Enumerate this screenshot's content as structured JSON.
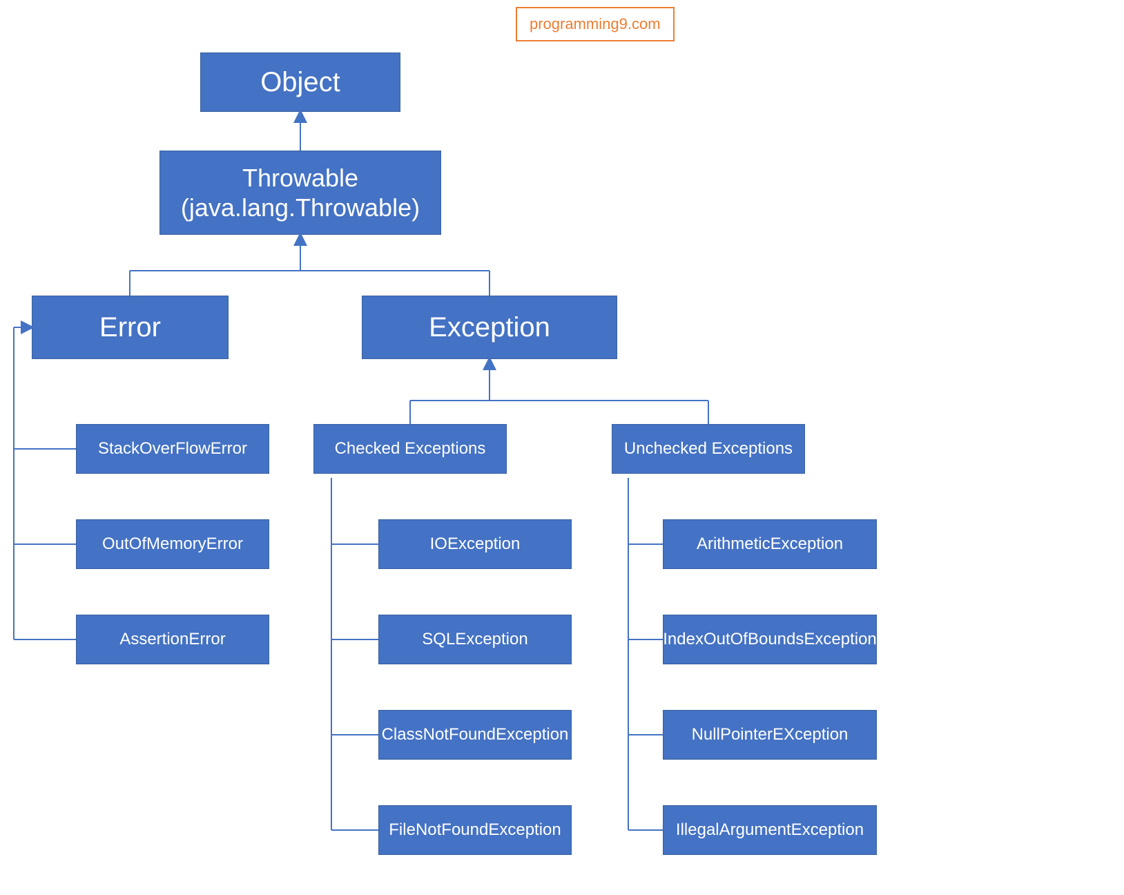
{
  "watermark": "programming9.com",
  "nodes": {
    "object": "Object",
    "throwable_line1": "Throwable",
    "throwable_line2": "(java.lang.Throwable)",
    "error": "Error",
    "exception": "Exception",
    "checked": "Checked Exceptions",
    "unchecked": "Unchecked Exceptions",
    "error_children": {
      "stackoverflow": "StackOverFlowError",
      "outofmemory": "OutOfMemoryError",
      "assertion": "AssertionError"
    },
    "checked_children": {
      "io": "IOException",
      "sql": "SQLException",
      "cnf": "ClassNotFoundException",
      "fnf": "FileNotFoundException"
    },
    "unchecked_children": {
      "arith": "ArithmeticException",
      "ioob": "IndexOutOfBoundsException",
      "npe": "NullPointerEXception",
      "iae": "IllegalArgumentException"
    }
  },
  "colors": {
    "box_fill": "#4472C4",
    "watermark": "#ED7D31"
  },
  "chart_data": {
    "type": "tree",
    "title": "Java Exception Hierarchy",
    "root": {
      "name": "Object",
      "children": [
        {
          "name": "Throwable (java.lang.Throwable)",
          "children": [
            {
              "name": "Error",
              "children": [
                {
                  "name": "StackOverFlowError"
                },
                {
                  "name": "OutOfMemoryError"
                },
                {
                  "name": "AssertionError"
                }
              ]
            },
            {
              "name": "Exception",
              "children": [
                {
                  "name": "Checked Exceptions",
                  "children": [
                    {
                      "name": "IOException"
                    },
                    {
                      "name": "SQLException"
                    },
                    {
                      "name": "ClassNotFoundException"
                    },
                    {
                      "name": "FileNotFoundException"
                    }
                  ]
                },
                {
                  "name": "Unchecked Exceptions",
                  "children": [
                    {
                      "name": "ArithmeticException"
                    },
                    {
                      "name": "IndexOutOfBoundsException"
                    },
                    {
                      "name": "NullPointerEXception"
                    },
                    {
                      "name": "IllegalArgumentException"
                    }
                  ]
                }
              ]
            }
          ]
        }
      ]
    }
  }
}
